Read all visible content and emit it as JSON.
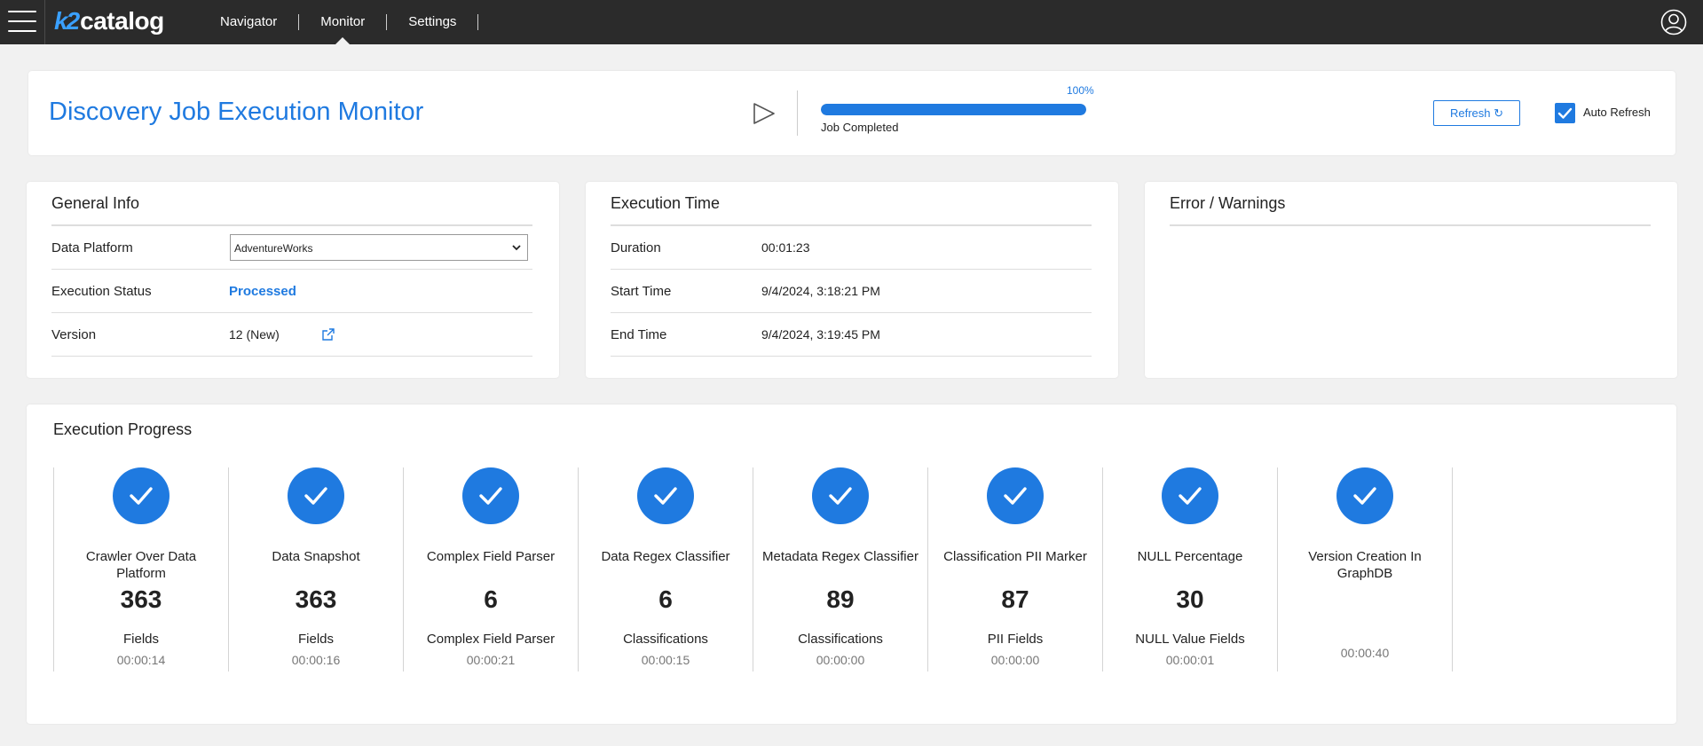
{
  "app": {
    "logo_k2": "k2",
    "logo_text": "catalog"
  },
  "nav": [
    {
      "label": "Navigator"
    },
    {
      "label": "Monitor",
      "active": true
    },
    {
      "label": "Settings"
    }
  ],
  "icons": {
    "menu": "hamburger-icon",
    "user": "user-circle-icon",
    "play": "play-icon",
    "refresh": "refresh-icon",
    "check": "checkmark-icon",
    "external": "external-link-icon"
  },
  "colors": {
    "accent": "#1f7ae0",
    "topbar": "#2b2b2b",
    "background": "#f1f1f1"
  },
  "header": {
    "title": "Discovery Job Execution Monitor",
    "progress_pct_label": "100%",
    "progress_value": 1.0,
    "progress_status": "Job Completed",
    "refresh_label": "Refresh ↻",
    "auto_refresh_label": "Auto Refresh",
    "auto_refresh_checked": true
  },
  "general_info": {
    "title": "General Info",
    "data_platform_label": "Data Platform",
    "data_platform_value": "AdventureWorks",
    "execution_status_label": "Execution Status",
    "execution_status_value": "Processed",
    "version_label": "Version",
    "version_value": "12 (New)"
  },
  "execution_time": {
    "title": "Execution Time",
    "duration_label": "Duration",
    "duration_value": "00:01:23",
    "start_label": "Start Time",
    "start_value": "9/4/2024, 3:18:21 PM",
    "end_label": "End Time",
    "end_value": "9/4/2024, 3:19:45 PM"
  },
  "errors": {
    "title": "Error / Warnings"
  },
  "execution_progress": {
    "title": "Execution Progress",
    "steps": [
      {
        "name": "Crawler Over Data Platform",
        "count": "363",
        "unit": "Fields",
        "time": "00:00:14"
      },
      {
        "name": "Data Snapshot",
        "count": "363",
        "unit": "Fields",
        "time": "00:00:16"
      },
      {
        "name": "Complex Field Parser",
        "count": "6",
        "unit": "Complex Field Parser",
        "time": "00:00:21"
      },
      {
        "name": "Data Regex Classifier",
        "count": "6",
        "unit": "Classifications",
        "time": "00:00:15"
      },
      {
        "name": "Metadata Regex Classifier",
        "count": "89",
        "unit": "Classifications",
        "time": "00:00:00"
      },
      {
        "name": "Classification PII Marker",
        "count": "87",
        "unit": "PII Fields",
        "time": "00:00:00"
      },
      {
        "name": "NULL Percentage",
        "count": "30",
        "unit": "NULL Value Fields",
        "time": "00:00:01"
      },
      {
        "name": "Version Creation In GraphDB",
        "count": "",
        "unit": "",
        "time": "00:00:40"
      }
    ]
  }
}
